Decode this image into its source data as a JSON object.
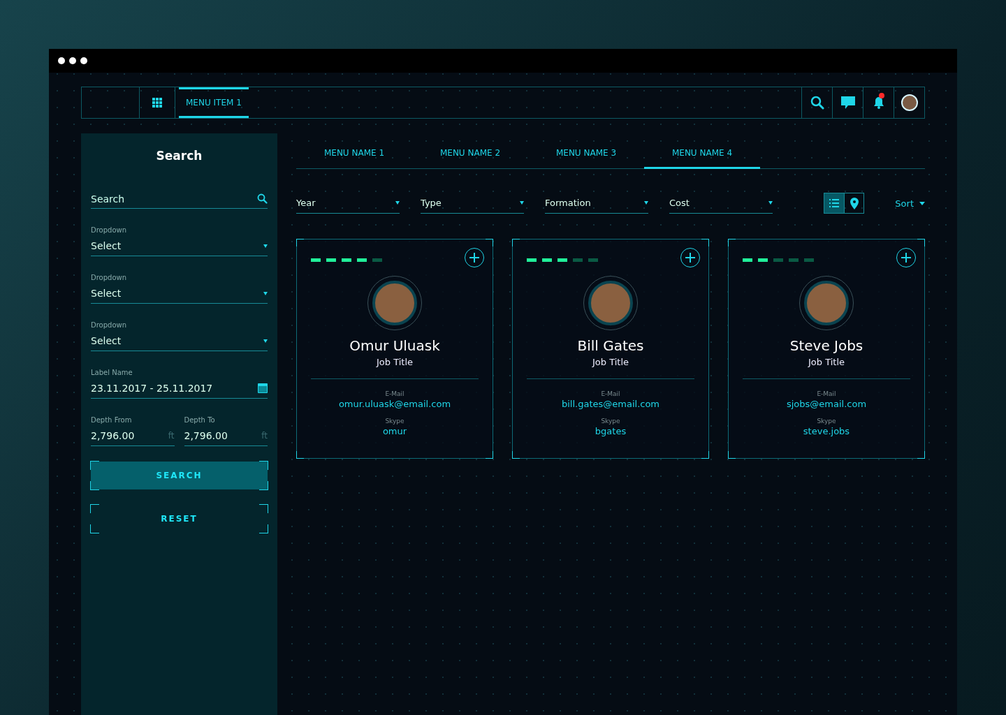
{
  "nav": {
    "items": [
      {
        "label": "MENU ITEM 1",
        "selected": true
      }
    ],
    "notification": true
  },
  "sidebar": {
    "title": "Search",
    "search": {
      "placeholder": "Search"
    },
    "dropdowns": [
      {
        "label": "Dropdown",
        "value": "Select"
      },
      {
        "label": "Dropdown",
        "value": "Select"
      },
      {
        "label": "Dropdown",
        "value": "Select"
      }
    ],
    "date": {
      "label": "Label Name",
      "value": "23.11.2017 - 25.11.2017"
    },
    "depth": [
      {
        "label": "Depth From",
        "value": "2,796.00",
        "unit": "ft"
      },
      {
        "label": "Depth To",
        "value": "2,796.00",
        "unit": "ft"
      }
    ],
    "buttons": [
      {
        "label": "SEARCH",
        "kind": "primary"
      },
      {
        "label": "RESET",
        "kind": "outline"
      }
    ]
  },
  "tabs": [
    {
      "label": "MENU NAME 1",
      "selected": false
    },
    {
      "label": "MENU NAME 2",
      "selected": false
    },
    {
      "label": "MENU NAME 3",
      "selected": false
    },
    {
      "label": "MENU NAME 4",
      "selected": true
    }
  ],
  "filters": [
    {
      "label": "Year"
    },
    {
      "label": "Type"
    },
    {
      "label": "Formation"
    },
    {
      "label": "Cost"
    }
  ],
  "views": [
    {
      "kind": "list",
      "selected": true
    },
    {
      "kind": "map",
      "selected": false
    }
  ],
  "sort": {
    "label": "Sort"
  },
  "cards": [
    {
      "name": "Omur Uluask",
      "title": "Job Title",
      "stars": 4,
      "email_label": "E-Mail",
      "email": "omur.uluask@email.com",
      "skype_label": "Skype",
      "skype": "omur"
    },
    {
      "name": "Bill Gates",
      "title": "Job Title",
      "stars": 3,
      "email_label": "E-Mail",
      "email": "bill.gates@email.com",
      "skype_label": "Skype",
      "skype": "bgates"
    },
    {
      "name": "Steve Jobs",
      "title": "Job Title",
      "stars": 2,
      "email_label": "E-Mail",
      "email": "sjobs@email.com",
      "skype_label": "Skype",
      "skype": "steve.jobs"
    }
  ]
}
